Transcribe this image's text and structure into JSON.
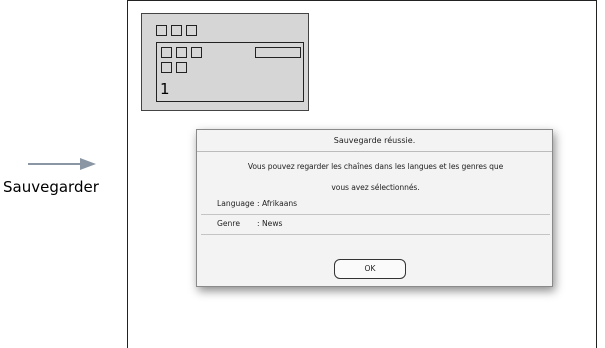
{
  "instruction": {
    "arrow_icon": "right-arrow-icon",
    "caption": "Sauvegarder"
  },
  "preview": {
    "channel_number": "1"
  },
  "dialog": {
    "title": "Sauvegarde réussie.",
    "message_line_1": "Vous pouvez regarder les chaînes dans les langues et les genres que",
    "message_line_2": "vous avez sélectionnés.",
    "language_label": "Language",
    "language_value": ": Afrikaans",
    "genre_label": "Genre",
    "genre_value": ": News",
    "ok_label": "OK"
  },
  "colors": {
    "arrow": "#8a96a4",
    "preview_bg": "#d6d6d6",
    "dialog_bg": "#f3f3f3"
  }
}
